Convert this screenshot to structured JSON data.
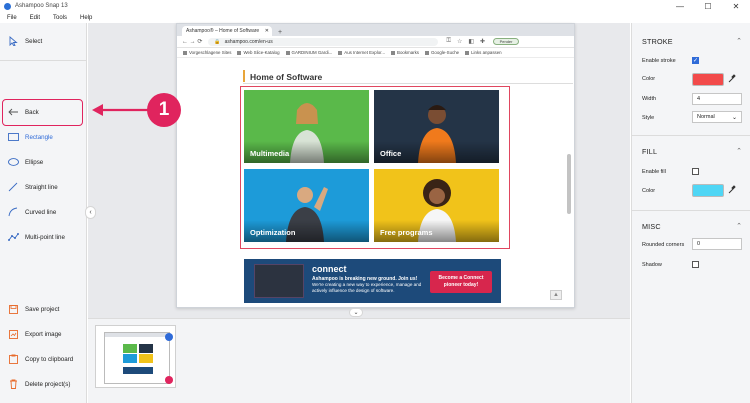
{
  "window": {
    "title": "Ashampoo Snap 13",
    "controls": [
      "—",
      "☐",
      "✕"
    ]
  },
  "menu": [
    "File",
    "Edit",
    "Tools",
    "Help"
  ],
  "tools": [
    {
      "label": "Select",
      "icon": "cursor-icon"
    },
    {
      "label": "Back",
      "icon": "arrow-left-icon"
    },
    {
      "label": "Rectangle",
      "icon": "rectangle-icon"
    },
    {
      "label": "Ellipse",
      "icon": "ellipse-icon"
    },
    {
      "label": "Straight line",
      "icon": "straight-line-icon"
    },
    {
      "label": "Curved line",
      "icon": "curved-line-icon"
    },
    {
      "label": "Multi-point line",
      "icon": "multi-point-line-icon"
    }
  ],
  "actions": [
    {
      "label": "Save project",
      "icon": "save-icon"
    },
    {
      "label": "Export image",
      "icon": "export-icon"
    },
    {
      "label": "Copy to clipboard",
      "icon": "clipboard-icon"
    },
    {
      "label": "Delete project(s)",
      "icon": "trash-icon"
    }
  ],
  "browser": {
    "tab_title": "Ashampoo® – Home of Software",
    "url": "ashampoo.com/en-us",
    "profile": "Pender",
    "bookmarks": [
      "Vorgeschlagene Sites",
      "Web Slice-Katalog",
      "GARDINIUM Gardi...",
      "Aus Internet Explor...",
      "Bookmarks",
      "Google-Suche",
      "Links anpassen"
    ]
  },
  "page": {
    "heading": "Home of Software",
    "tiles": [
      {
        "label": "Multimedia",
        "color": "#5ab94a"
      },
      {
        "label": "Office",
        "color": "#243447"
      },
      {
        "label": "Optimization",
        "color": "#1d9bd9"
      },
      {
        "label": "Free programs",
        "color": "#f1c31a"
      }
    ],
    "banner": {
      "logo": "connect",
      "title": "Ashampoo is breaking new ground. Join us!",
      "text": "We're creating a new way to experience, manage and actively influence the design of software.",
      "cta": "Become a Connect pioneer today!"
    }
  },
  "annotation": {
    "badge": "1",
    "color": "#e0245e"
  },
  "properties": {
    "stroke": {
      "title": "STROKE",
      "enable_label": "Enable stroke",
      "enabled": true,
      "color_label": "Color",
      "color": "#f24a4a",
      "width_label": "Width",
      "width": "4",
      "style_label": "Style",
      "style": "Normal"
    },
    "fill": {
      "title": "FILL",
      "enable_label": "Enable fill",
      "enabled": false,
      "color_label": "Color",
      "color": "#4fd6f5"
    },
    "misc": {
      "title": "MISC",
      "corners_label": "Rounded corners",
      "corners": "0",
      "shadow_label": "Shadow",
      "shadow": false
    }
  }
}
